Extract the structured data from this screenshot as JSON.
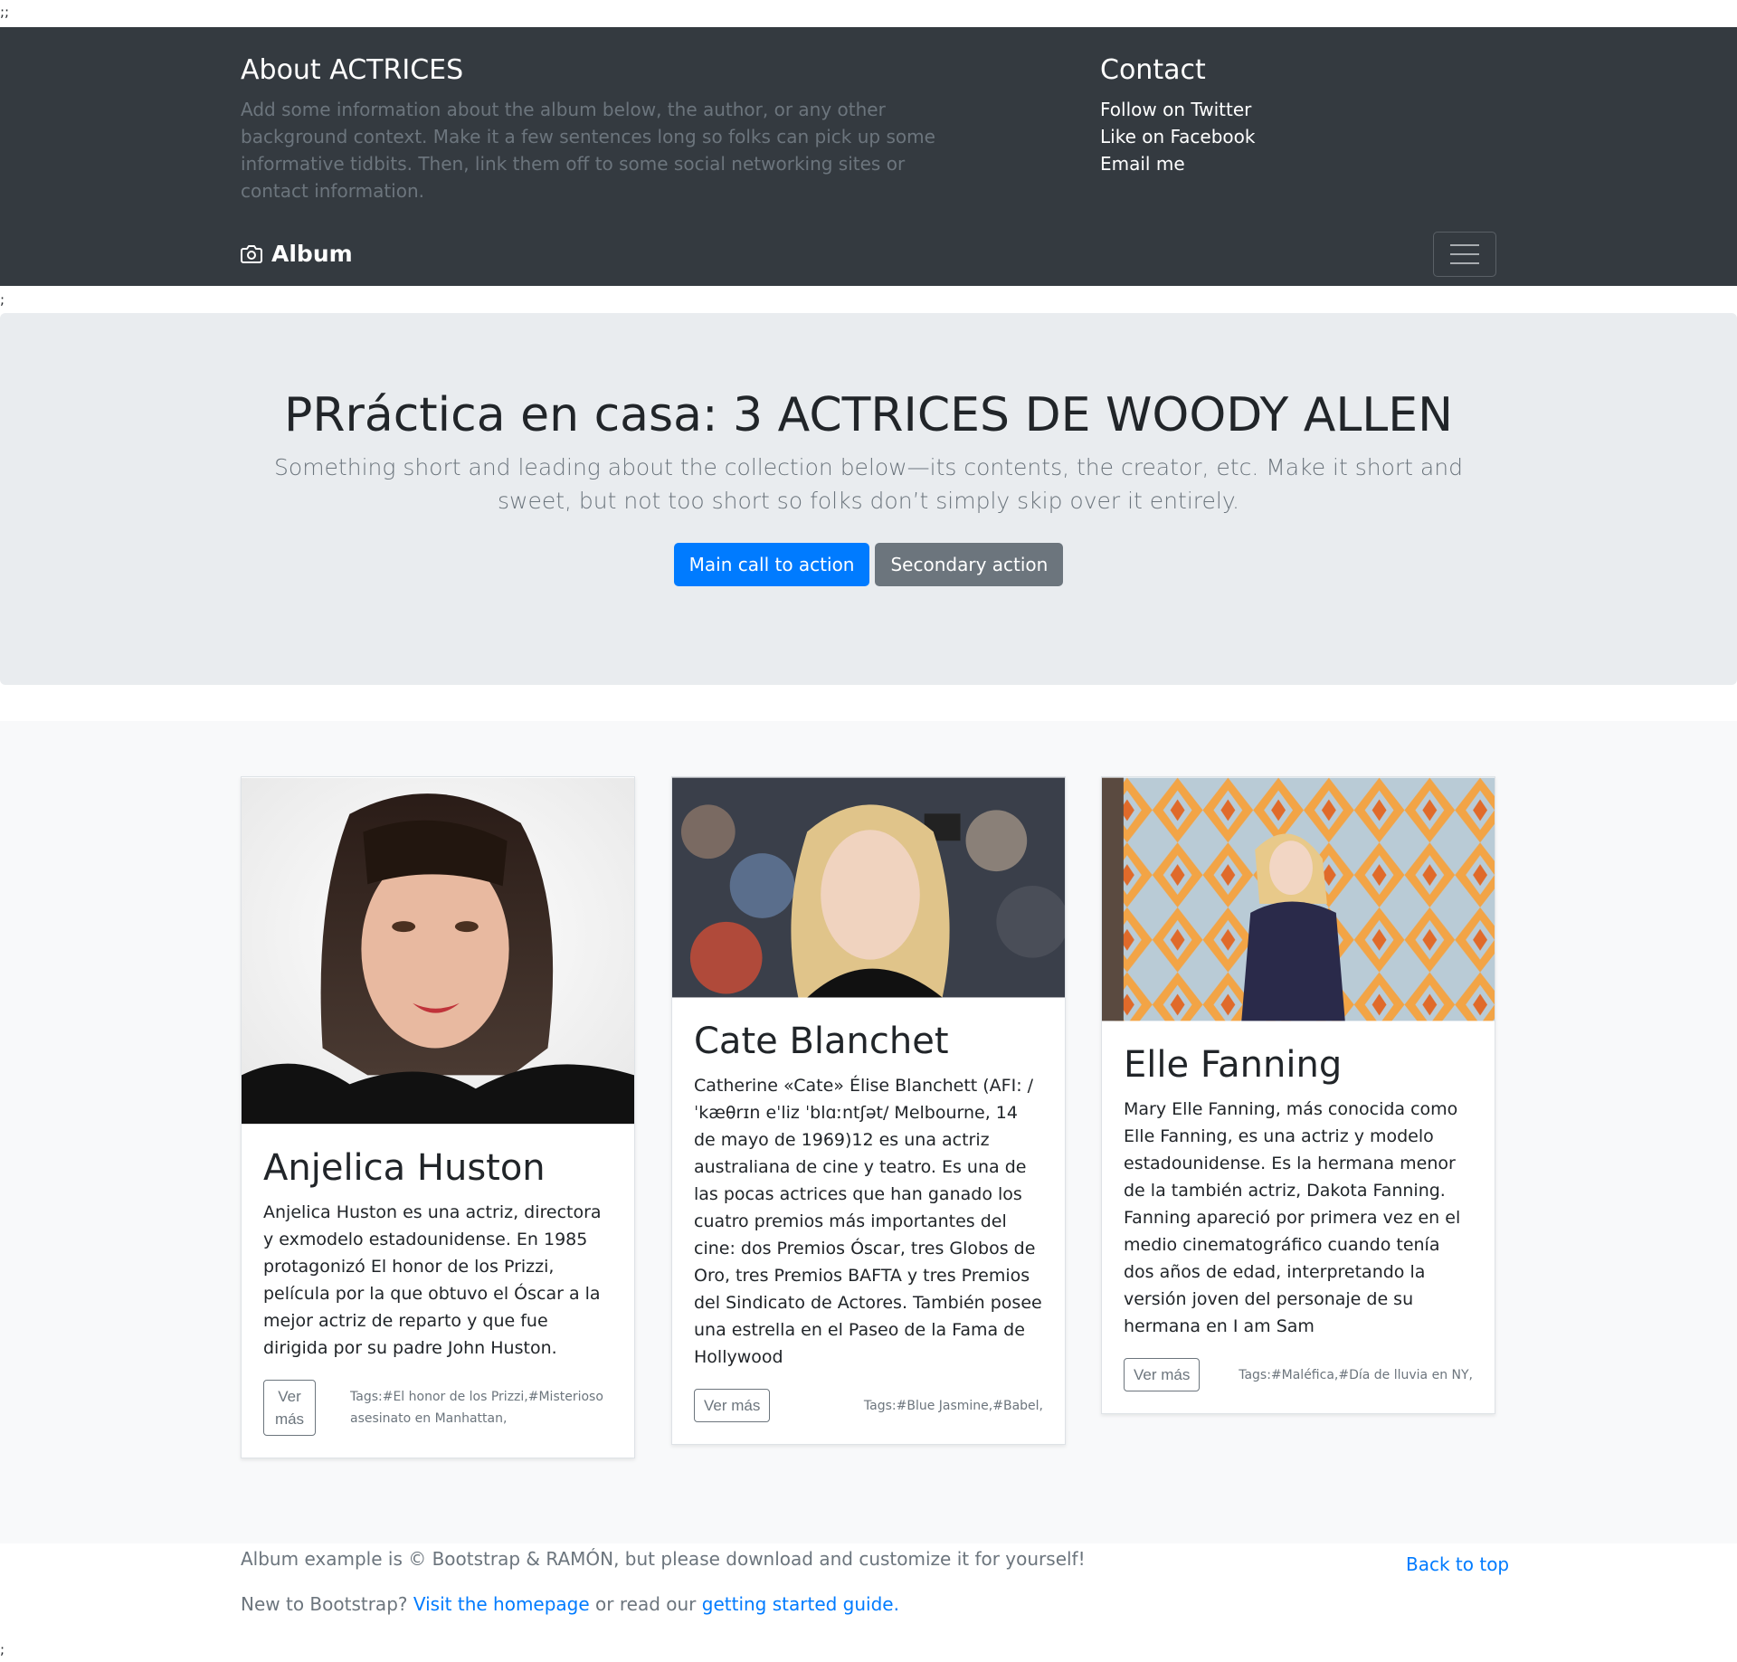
{
  "stray_marks": {
    "top": ";;",
    "middle": ";",
    "bottom": ";"
  },
  "header": {
    "about_title": "About ACTRICES",
    "about_text": "Add some information about the album below, the author, or any other background context. Make it a few sentences long so folks can pick up some informative tidbits. Then, link them off to some social networking sites or contact information.",
    "contact_title": "Contact",
    "contact_links": [
      "Follow on Twitter",
      "Like on Facebook",
      "Email me"
    ],
    "brand": "Album",
    "brand_icon": "camera-icon",
    "toggler_icon": "hamburger-icon"
  },
  "hero": {
    "title": "PRráctica en casa: 3 ACTRICES DE WOODY ALLEN",
    "lead": "Something short and leading about the collection below—its contents, the creator, etc. Make it short and sweet, but not too short so folks don’t simply skip over it entirely.",
    "primary_button": "Main call to action",
    "secondary_button": "Secondary action"
  },
  "cards": [
    {
      "name": "Anjelica Huston",
      "text": "Anjelica Huston es una actriz, directora y exmodelo estadounidense. En 1985 protagonizó El honor de los Prizzi, película por la que obtuvo el Óscar a la mejor actriz de reparto y que fue dirigida por su padre John Huston.",
      "button": "Ver más",
      "tags": "Tags:#El honor de los Prizzi,#Misterioso asesinato en Manhattan,"
    },
    {
      "name": "Cate Blanchet",
      "text": "Catherine «Cate» Élise Blanchett (AFI: /ˈkæθrɪn eˈliz ˈblɑːntʃət/ Melbourne, 14 de mayo de 1969)12 es una actriz australiana de cine y teatro. Es una de las pocas actrices que han ganado los cuatro premios más importantes del cine: dos Premios Óscar, tres Globos de Oro, tres Premios BAFTA y tres Premios del Sindicato de Actores. También posee una estrella en el Paseo de la Fama de Hollywood",
      "button": "Ver más",
      "tags": "Tags:#Blue Jasmine,#Babel,"
    },
    {
      "name": "Elle Fanning",
      "text": "Mary Elle Fanning, más conocida como Elle Fanning, es una actriz y modelo estadounidense. Es la hermana menor de la también actriz, Dakota Fanning. Fanning apareció por primera vez en el medio cinematográfico cuando tenía dos años de edad, interpretando la versión joven del personaje de su hermana en I am Sam",
      "button": "Ver más",
      "tags": "Tags:#Maléfica,#Día de lluvia en NY,"
    }
  ],
  "footer": {
    "copyright": "Album example is © Bootstrap & RAMÓN, but please download and customize it for yourself!",
    "back_to_top": "Back to top",
    "new_prefix": "New to Bootstrap?",
    "homepage_link": "Visit the homepage",
    "middle": "or read our",
    "guide_link": "getting started guide."
  },
  "colors": {
    "header_bg": "#343a40",
    "jumbo_bg": "#e9ecef",
    "primary": "#007bff",
    "secondary": "#6c757d",
    "album_bg": "#f8f9fa"
  }
}
